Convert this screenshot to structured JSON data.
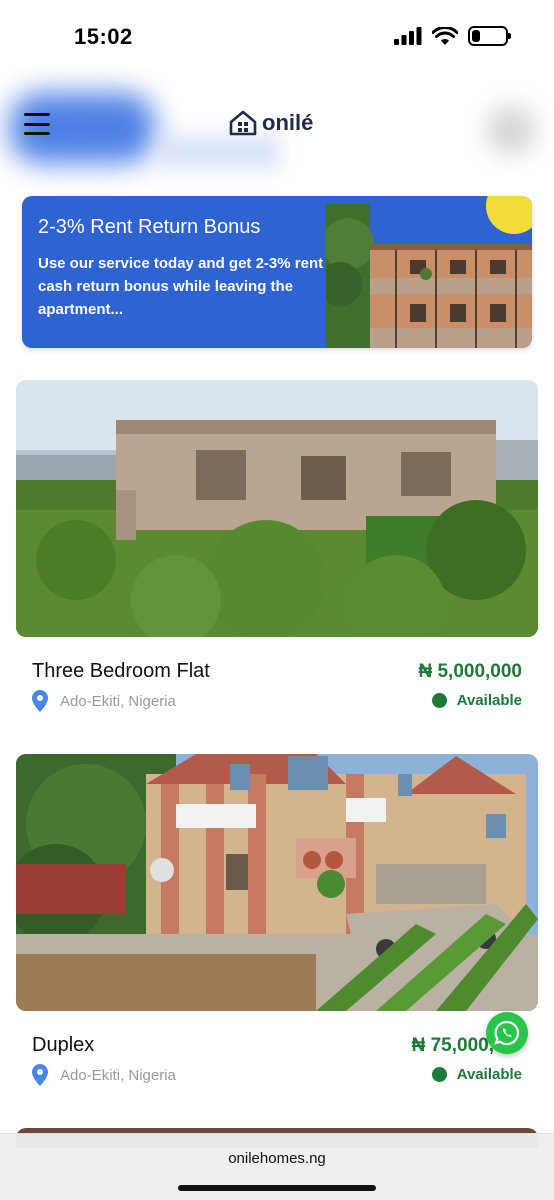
{
  "status_bar": {
    "time": "15:02",
    "battery_level": 0.25
  },
  "header": {
    "logo_text": "onilé",
    "menu_icon": "hamburger-menu-icon",
    "logo_icon": "house-icon"
  },
  "promo": {
    "title": "2-3% Rent Return Bonus",
    "body": "Use our service today and get 2-3% rent cash return bonus while leaving the apartment...",
    "background_color": "#2f63d2"
  },
  "listings": [
    {
      "title": "Three Bedroom Flat",
      "price": "₦ 5,000,000",
      "location": "Ado-Ekiti, Nigeria",
      "status": "Available"
    },
    {
      "title": "Duplex",
      "price": "₦ 75,000,",
      "location": "Ado-Ekiti, Nigeria",
      "status": "Available"
    }
  ],
  "browser": {
    "url": "onilehomes.ng"
  },
  "colors": {
    "accent_green": "#1e7a3a",
    "brand_blue": "#2f63d2",
    "whatsapp_green": "#29c54a"
  }
}
